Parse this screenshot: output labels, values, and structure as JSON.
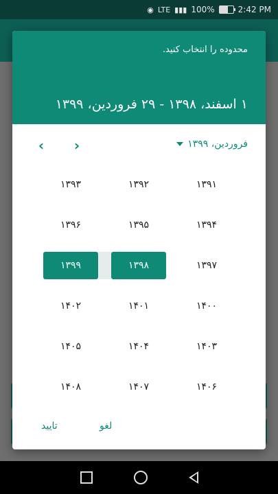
{
  "status_bar": {
    "network": "LTE",
    "battery": "100%",
    "time": "2:42 PM"
  },
  "dialog": {
    "prompt": "محدوده را انتخاب کنید.",
    "selected_range": "۱ اسفند، ۱۳۹۸ - ۲۹ فروردین، ۱۳۹۹",
    "month_label": "فروردین، ۱۳۹۹",
    "years": [
      "۱۳۹۱",
      "۱۳۹۲",
      "۱۳۹۳",
      "۱۳۹۴",
      "۱۳۹۵",
      "۱۳۹۶",
      "۱۳۹۷",
      "۱۳۹۸",
      "۱۳۹۹",
      "۱۴۰۰",
      "۱۴۰۱",
      "۱۴۰۲",
      "۱۴۰۳",
      "۱۴۰۴",
      "۱۴۰۵",
      "۱۴۰۶",
      "۱۴۰۷",
      "۱۴۰۸"
    ],
    "selected_years": [
      "۱۳۹۸",
      "۱۳۹۹"
    ],
    "cancel_label": "لغو",
    "confirm_label": "تایید"
  },
  "colors": {
    "accent": "#0f8a77",
    "header": "#0f8a77",
    "status_bar": "#0a3b34"
  }
}
